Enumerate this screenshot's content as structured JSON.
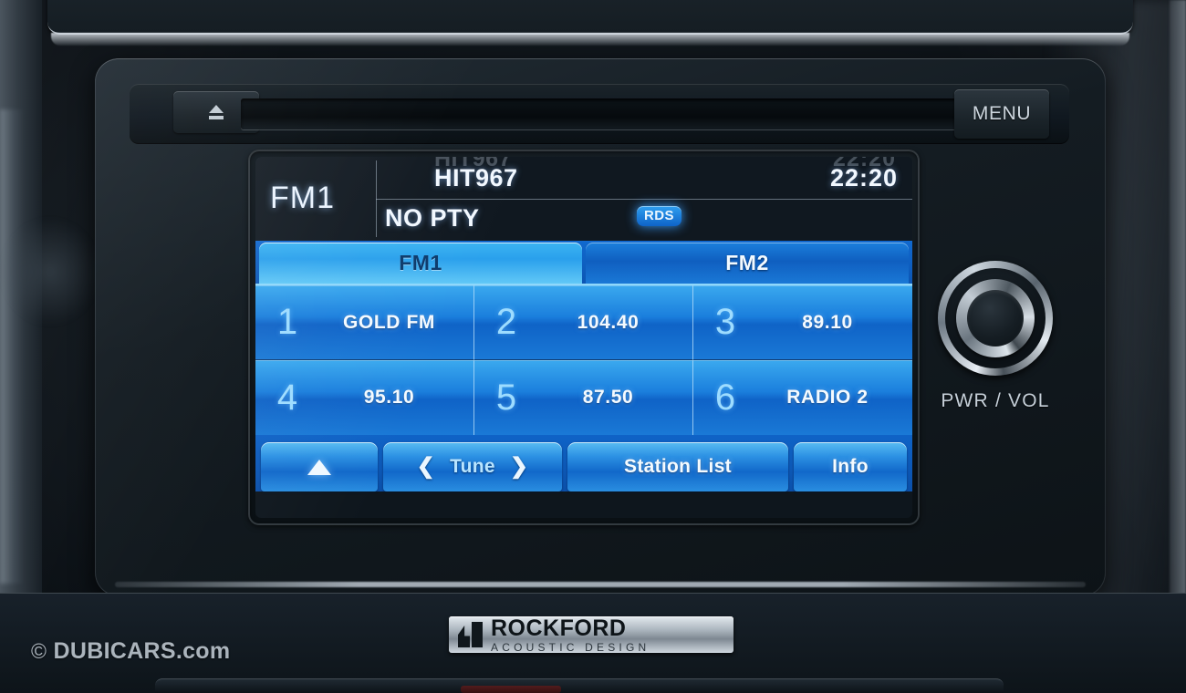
{
  "head_unit": {
    "eject_button_label": "",
    "menu_button_label": "MENU",
    "knob_label": "PWR / VOL"
  },
  "screen": {
    "band": "FM1",
    "station_name": "HIT967",
    "ghost_station_name": "HIT967",
    "clock": "22:20",
    "ghost_clock": "22:20",
    "program_type": "NO PTY",
    "rds_badge": "RDS",
    "tabs": [
      {
        "label": "FM1",
        "active": true
      },
      {
        "label": "FM2",
        "active": false
      }
    ],
    "presets": [
      {
        "number": "1",
        "label": "GOLD FM"
      },
      {
        "number": "2",
        "label": "104.40"
      },
      {
        "number": "3",
        "label": "89.10"
      },
      {
        "number": "4",
        "label": "95.10"
      },
      {
        "number": "5",
        "label": "87.50"
      },
      {
        "number": "6",
        "label": "RADIO 2"
      }
    ],
    "softkeys": {
      "scroll_up": "",
      "tune": "Tune",
      "tune_prev": "❮",
      "tune_next": "❯",
      "station_list": "Station List",
      "info": "Info"
    }
  },
  "badge": {
    "brand": "ROCKFORD",
    "tagline": "ACOUSTIC DESIGN"
  },
  "watermark": {
    "symbol": "©",
    "text": "DUBICARS.com"
  },
  "colors": {
    "screen_blue": "#1b7fdd",
    "accent_cyan": "#9ddcff",
    "tab_active": "#3bb4f2",
    "text_white": "#f2f8ff",
    "panel_dark": "#141c22"
  }
}
